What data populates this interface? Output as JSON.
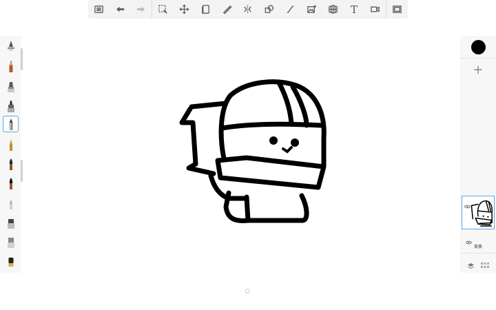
{
  "toolbar": {
    "items": [
      {
        "name": "list-icon"
      },
      {
        "name": "undo-icon"
      },
      {
        "name": "redo-icon"
      },
      {
        "name": "selection-icon"
      },
      {
        "name": "transform-icon"
      },
      {
        "name": "layer-stack-icon"
      },
      {
        "name": "ruler-icon"
      },
      {
        "name": "symmetry-icon"
      },
      {
        "name": "shape-icon"
      },
      {
        "name": "curve-icon"
      },
      {
        "name": "add-image-icon"
      },
      {
        "name": "perspective-icon"
      },
      {
        "name": "text-icon",
        "label": "T"
      },
      {
        "name": "video-icon"
      },
      {
        "name": "fullscreen-icon"
      }
    ]
  },
  "brushes": [
    {
      "name": "blender-brush",
      "color": "#555555"
    },
    {
      "name": "pencil-brush",
      "color": "#b05a2a"
    },
    {
      "name": "marker-brush",
      "color": "#6a6a6a"
    },
    {
      "name": "airbrush-brush",
      "color": "#444444"
    },
    {
      "name": "pen-brush",
      "color": "#8a8a8a",
      "selected": true
    },
    {
      "name": "fountain-pen-brush",
      "color": "#c78a2a"
    },
    {
      "name": "ink-brush",
      "color": "#5a3a1a"
    },
    {
      "name": "paint-brush",
      "color": "#3a2a1a"
    },
    {
      "name": "fine-brush",
      "color": "#999999"
    },
    {
      "name": "eraser-brush",
      "color": "#777777"
    },
    {
      "name": "soft-eraser-brush",
      "color": "#888888"
    },
    {
      "name": "fill-brush",
      "color": "#222222"
    }
  ],
  "color_panel": {
    "current_color": "#000000",
    "add_label": "+"
  },
  "layers": {
    "background_label": "背景"
  },
  "accent_color": "#5aa7e6"
}
